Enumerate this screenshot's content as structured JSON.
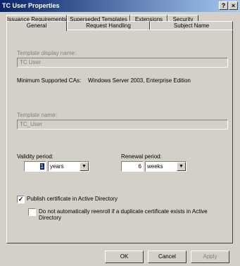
{
  "window": {
    "title": "TC User Properties",
    "help_label": "?",
    "close_label": "×"
  },
  "tabs_top": [
    {
      "label": "Issuance Requirements"
    },
    {
      "label": "Superseded Templates"
    },
    {
      "label": "Extensions"
    },
    {
      "label": "Security"
    }
  ],
  "tabs_bottom": [
    {
      "label": "General"
    },
    {
      "label": "Request Handling"
    },
    {
      "label": "Subject Name"
    }
  ],
  "general": {
    "display_name_label": "Template display name:",
    "display_name_value": "TC User",
    "min_ca_label": "Minimum Supported CAs:",
    "min_ca_value": "Windows Server 2003, Enterprise Edition",
    "template_name_label": "Template name:",
    "template_name_value": "TC_User",
    "validity_label": "Validity period:",
    "validity_value": "1",
    "validity_unit": "years",
    "renewal_label": "Renewal period:",
    "renewal_value": "6",
    "renewal_unit": "weeks",
    "publish_label": "Publish certificate in Active Directory",
    "publish_checked": true,
    "reenroll_label_line1": "Do not automatically reenroll if a duplicate certificate exists in Active",
    "reenroll_label_line2": "Directory",
    "reenroll_checked": false
  },
  "buttons": {
    "ok": "OK",
    "cancel": "Cancel",
    "apply": "Apply"
  }
}
